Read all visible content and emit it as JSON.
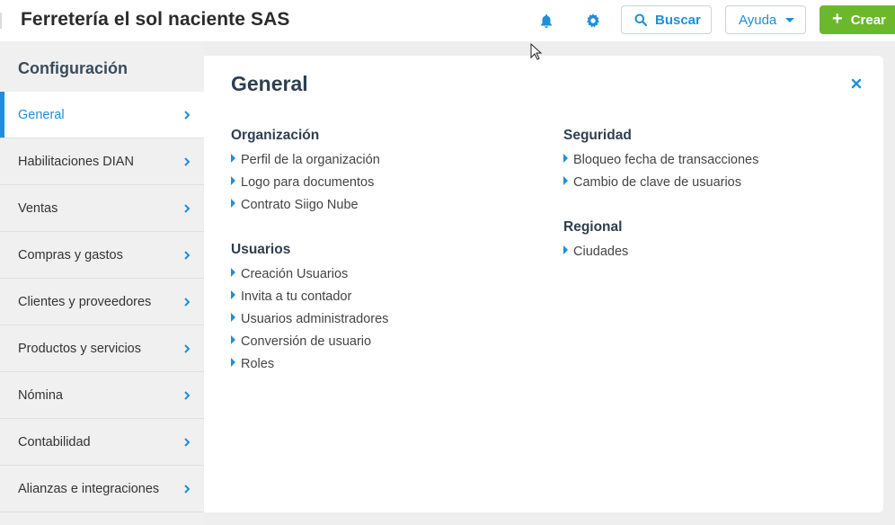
{
  "header": {
    "company": "Ferretería el sol naciente SAS",
    "bell_icon": "bell-icon",
    "gear_icon": "gear-icon",
    "search_label": "Buscar",
    "help_label": "Ayuda",
    "create_label": "Crear"
  },
  "colors": {
    "accent": "#1f8fd9",
    "create": "#6cb82c",
    "title": "#2f3f4f"
  },
  "sidebar": {
    "title": "Configuración",
    "items": [
      {
        "label": "General"
      },
      {
        "label": "Habilitaciones DIAN"
      },
      {
        "label": "Ventas"
      },
      {
        "label": "Compras y gastos"
      },
      {
        "label": "Clientes y proveedores"
      },
      {
        "label": "Productos y servicios"
      },
      {
        "label": "Nómina"
      },
      {
        "label": "Contabilidad"
      },
      {
        "label": "Alianzas e integraciones"
      }
    ]
  },
  "main": {
    "title": "General",
    "sections": {
      "organizacion": {
        "title": "Organización",
        "links": [
          "Perfil de la organización",
          "Logo para documentos",
          "Contrato Siigo Nube"
        ]
      },
      "usuarios": {
        "title": "Usuarios",
        "links": [
          "Creación Usuarios",
          "Invita a tu contador",
          "Usuarios administradores",
          "Conversión de usuario",
          "Roles"
        ]
      },
      "seguridad": {
        "title": "Seguridad",
        "links": [
          "Bloqueo fecha de transacciones",
          "Cambio de clave de usuarios"
        ]
      },
      "regional": {
        "title": "Regional",
        "links": [
          "Ciudades"
        ]
      }
    }
  }
}
